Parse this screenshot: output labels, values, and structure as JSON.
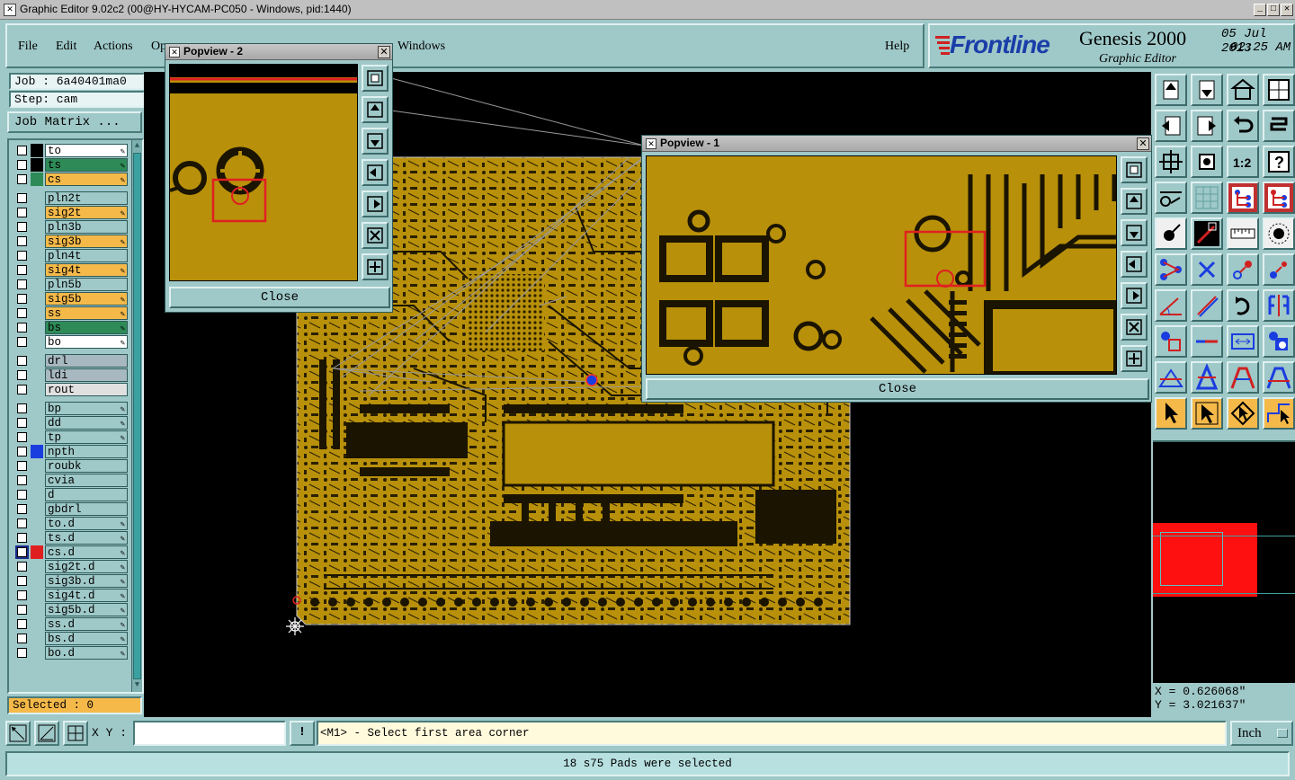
{
  "window": {
    "title": "Graphic Editor 9.02c2 (00@HY-HYCAM-PC050 - Windows, pid:1440)"
  },
  "menu": {
    "file": "File",
    "edit": "Edit",
    "actions": "Actions",
    "options": "Op",
    "windows": "Windows",
    "help": "Help"
  },
  "brand": {
    "logo": "Frontline",
    "product": "Genesis 2000",
    "subtitle": "Graphic Editor",
    "date": "05 Jul 2013",
    "time": "02:25 AM"
  },
  "job": {
    "job": "Job : 6a40401ma0",
    "step": "Step: cam",
    "matrix_button": "Job Matrix ..."
  },
  "layers": [
    {
      "name": "to",
      "bg": "#ffffff",
      "color": "#000000",
      "pen": true
    },
    {
      "name": "ts",
      "bg": "#2e8b57",
      "color": "#000000",
      "pen": true
    },
    {
      "name": "cs",
      "bg": "#f5b94a",
      "color": "#2e8b57",
      "pen": true
    },
    {
      "name": "pln2t",
      "bg": "#9fc8c8",
      "color": "",
      "pen": false
    },
    {
      "name": "sig2t",
      "bg": "#f5b94a",
      "color": "",
      "pen": true
    },
    {
      "name": "pln3b",
      "bg": "#9fc8c8",
      "color": "",
      "pen": false
    },
    {
      "name": "sig3b",
      "bg": "#f5b94a",
      "color": "",
      "pen": true
    },
    {
      "name": "pln4t",
      "bg": "#9fc8c8",
      "color": "",
      "pen": false
    },
    {
      "name": "sig4t",
      "bg": "#f5b94a",
      "color": "",
      "pen": true
    },
    {
      "name": "pln5b",
      "bg": "#9fc8c8",
      "color": "",
      "pen": false
    },
    {
      "name": "sig5b",
      "bg": "#f5b94a",
      "color": "",
      "pen": true
    },
    {
      "name": "ss",
      "bg": "#f5b94a",
      "color": "",
      "pen": true
    },
    {
      "name": "bs",
      "bg": "#2e8b57",
      "color": "",
      "pen": true
    },
    {
      "name": "bo",
      "bg": "#ffffff",
      "color": "",
      "pen": true
    },
    {
      "name": "drl",
      "bg": "#a8b8c0",
      "color": "",
      "pen": false
    },
    {
      "name": "ldi",
      "bg": "#a8b8c0",
      "color": "",
      "pen": false
    },
    {
      "name": "rout",
      "bg": "#e0e0e0",
      "color": "",
      "pen": false
    },
    {
      "name": "bp",
      "bg": "#9fc8c8",
      "color": "",
      "pen": true
    },
    {
      "name": "dd",
      "bg": "#9fc8c8",
      "color": "",
      "pen": true
    },
    {
      "name": "tp",
      "bg": "#9fc8c8",
      "color": "",
      "pen": true
    },
    {
      "name": "npth",
      "bg": "#9fc8c8",
      "color": "#1a3de0",
      "pen": false
    },
    {
      "name": "roubk",
      "bg": "#9fc8c8",
      "color": "",
      "pen": false
    },
    {
      "name": "cvia",
      "bg": "#9fc8c8",
      "color": "",
      "pen": false
    },
    {
      "name": "d",
      "bg": "#9fc8c8",
      "color": "",
      "pen": false
    },
    {
      "name": "gbdrl",
      "bg": "#9fc8c8",
      "color": "",
      "pen": false
    },
    {
      "name": "to.d",
      "bg": "#9fc8c8",
      "color": "",
      "pen": true
    },
    {
      "name": "ts.d",
      "bg": "#9fc8c8",
      "color": "",
      "pen": true
    },
    {
      "name": "cs.d",
      "bg": "#9fc8c8",
      "color": "#e02020",
      "pen": true
    },
    {
      "name": "sig2t.d",
      "bg": "#9fc8c8",
      "color": "",
      "pen": true
    },
    {
      "name": "sig3b.d",
      "bg": "#9fc8c8",
      "color": "",
      "pen": true
    },
    {
      "name": "sig4t.d",
      "bg": "#9fc8c8",
      "color": "",
      "pen": true
    },
    {
      "name": "sig5b.d",
      "bg": "#9fc8c8",
      "color": "",
      "pen": true
    },
    {
      "name": "ss.d",
      "bg": "#9fc8c8",
      "color": "",
      "pen": true
    },
    {
      "name": "bs.d",
      "bg": "#9fc8c8",
      "color": "",
      "pen": true
    },
    {
      "name": "bo.d",
      "bg": "#9fc8c8",
      "color": "",
      "pen": true
    }
  ],
  "selected": "Selected : 0",
  "popview2": {
    "title": "Popview - 2",
    "close": "Close"
  },
  "popview1": {
    "title": "Popview - 1",
    "close": "Close"
  },
  "coords": {
    "x": "X = 0.626068\"",
    "y": "Y = 3.021637\""
  },
  "command": {
    "xy_label": "X Y :",
    "xy_value": "",
    "prompt": "<M1> - Select first area corner",
    "units": "Inch"
  },
  "status": {
    "message": "18 s75 Pads were selected"
  },
  "colors": {
    "board": "#b8900a",
    "accent": "#9fc8c8",
    "highlight": "#e02020"
  }
}
